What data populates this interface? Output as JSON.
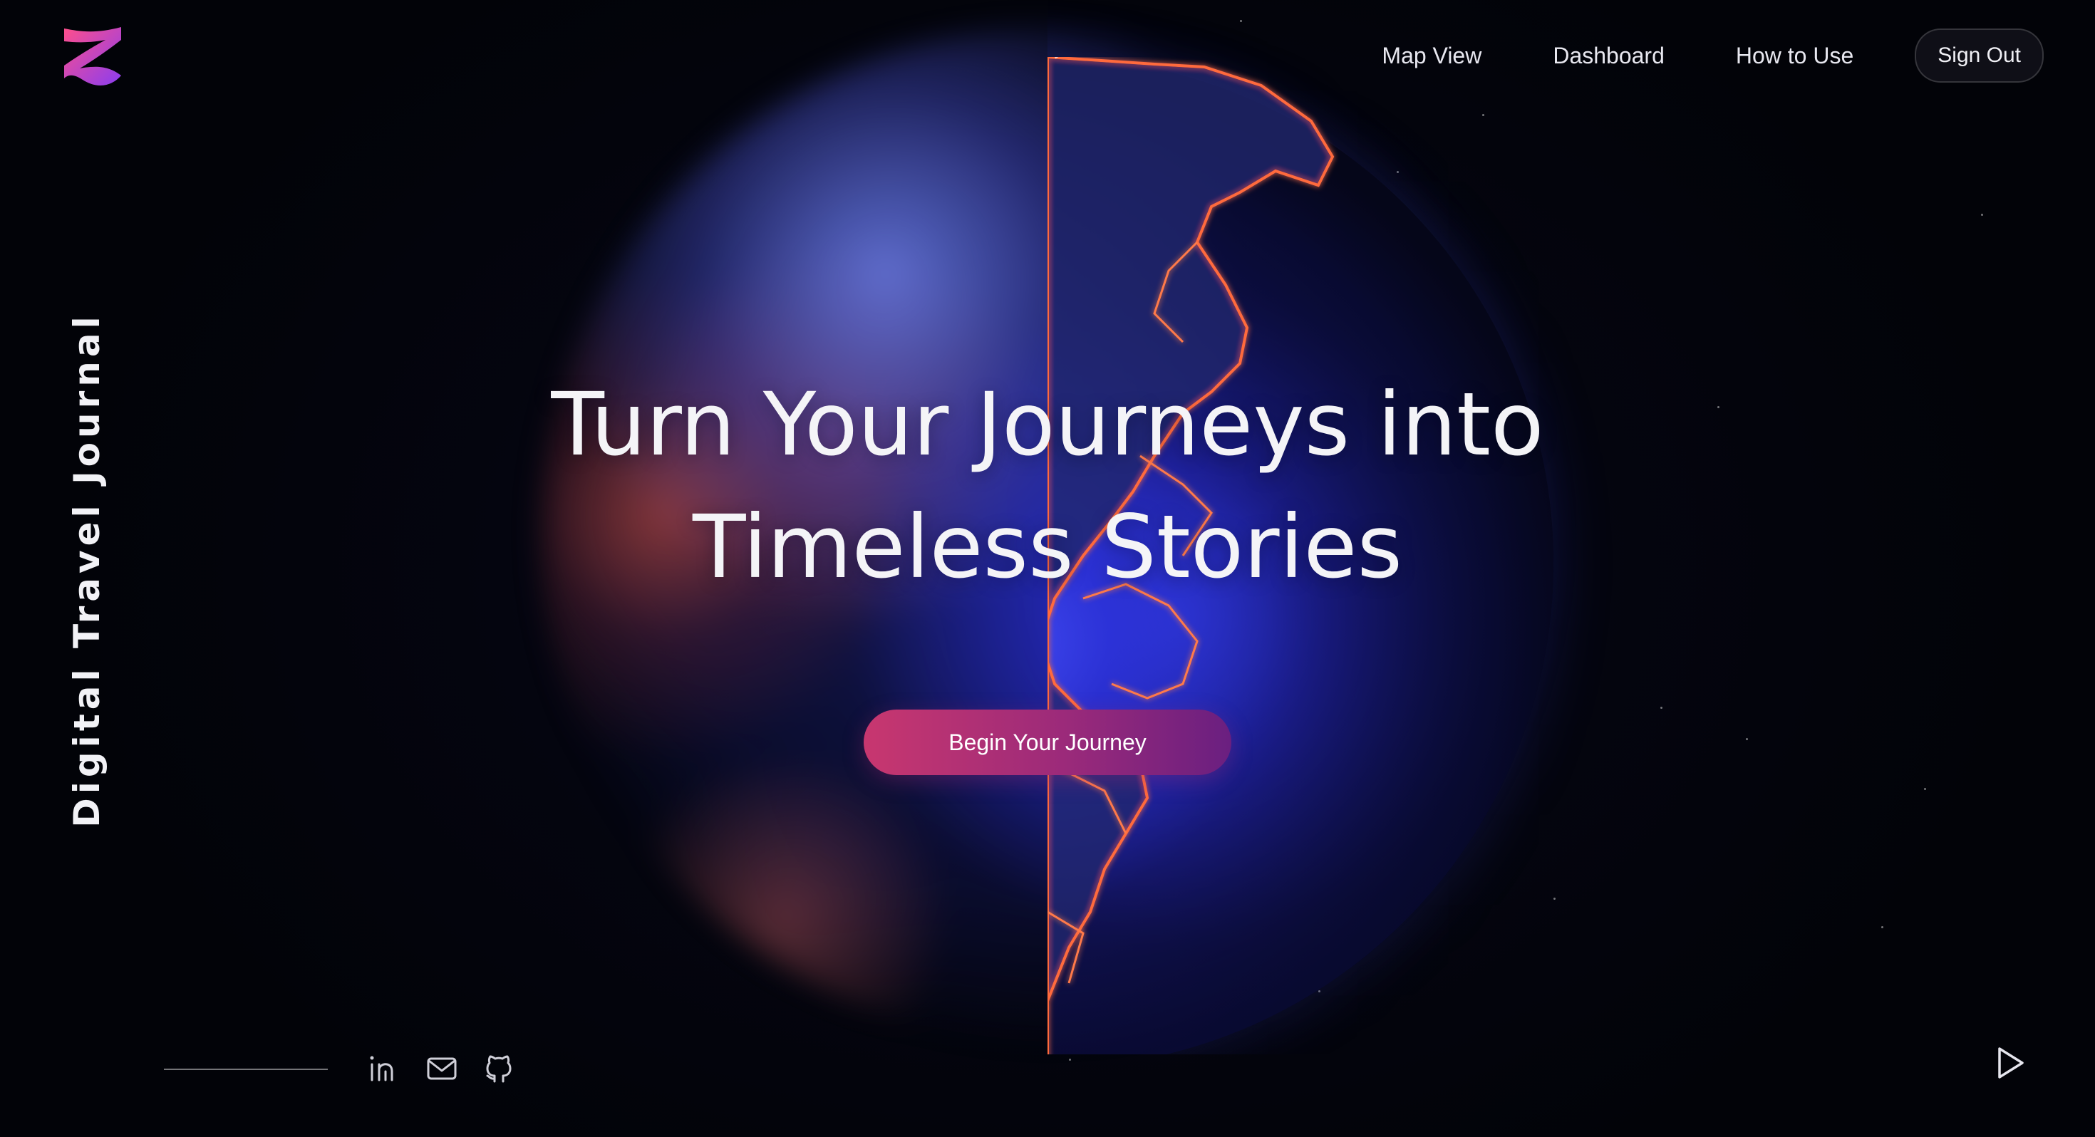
{
  "app": {
    "vertical_title": "Digital Travel Journal",
    "logo_icon": "brand-logo-icon"
  },
  "nav": {
    "items": [
      {
        "label": "Map View"
      },
      {
        "label": "Dashboard"
      },
      {
        "label": "How to Use"
      }
    ],
    "signout_label": "Sign Out"
  },
  "hero": {
    "line1": "Turn Your Journeys into",
    "line2": "Timeless Stories",
    "cta_label": "Begin Your Journey"
  },
  "footer": {
    "socials": [
      {
        "icon": "linkedin-icon"
      },
      {
        "icon": "mail-icon"
      },
      {
        "icon": "github-icon"
      }
    ],
    "play_icon": "play-icon"
  },
  "colors": {
    "background": "#03040c",
    "cta_start": "#c8376f",
    "cta_end": "#6a1f80",
    "globe_blue": "#3f4cff",
    "border_glow": "#ff6a3d"
  }
}
